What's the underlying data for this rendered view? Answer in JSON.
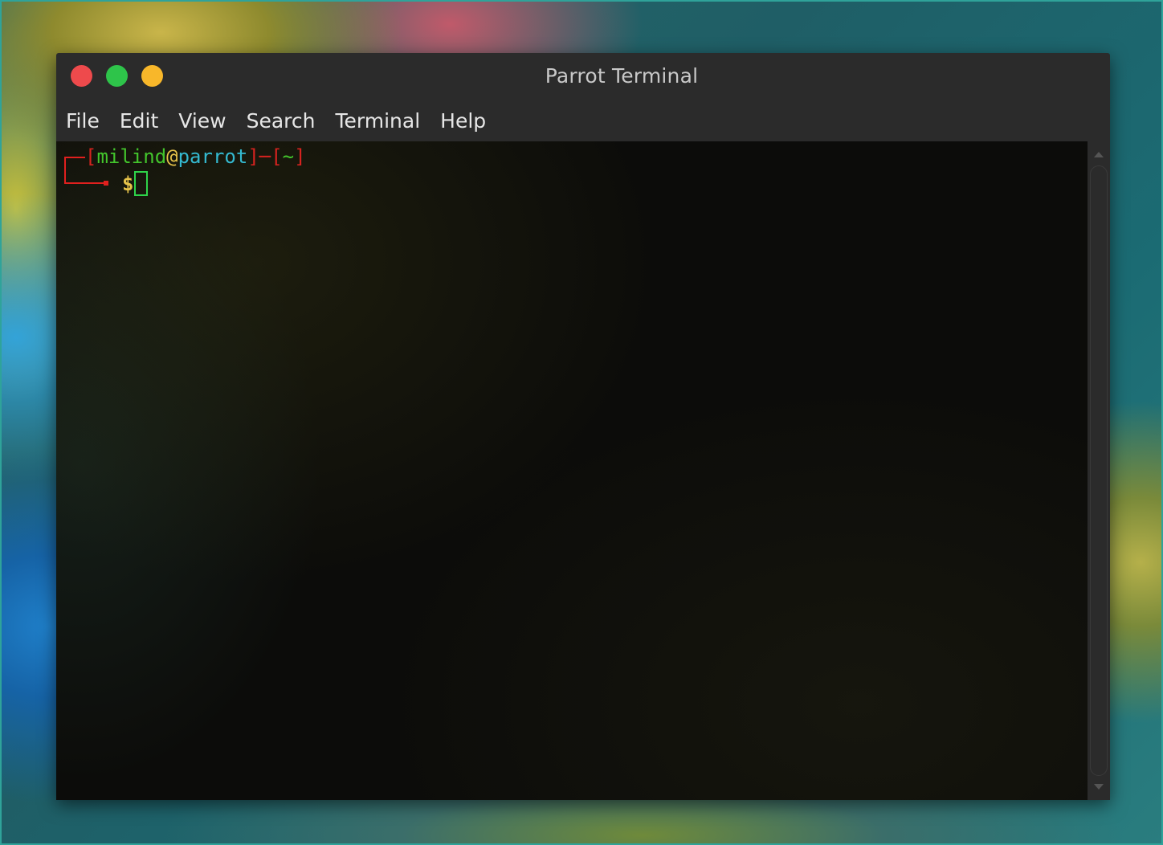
{
  "window": {
    "title": "Parrot Terminal",
    "controls": [
      "close",
      "minimize",
      "maximize"
    ]
  },
  "menubar": {
    "items": [
      "File",
      "Edit",
      "View",
      "Search",
      "Terminal",
      "Help"
    ]
  },
  "terminal": {
    "prompt": {
      "open_bracket": "[",
      "user": "milind",
      "at": "@",
      "host": "parrot",
      "close_bracket": "]",
      "separator": "─",
      "dir_open": "[",
      "dir": "~",
      "dir_close": "]",
      "symbol": "$"
    },
    "colors": {
      "bracket": "#d5231f",
      "user": "#43c52c",
      "at": "#e6c34a",
      "host": "#34b9d0",
      "cursor": "#2ed44a"
    }
  }
}
